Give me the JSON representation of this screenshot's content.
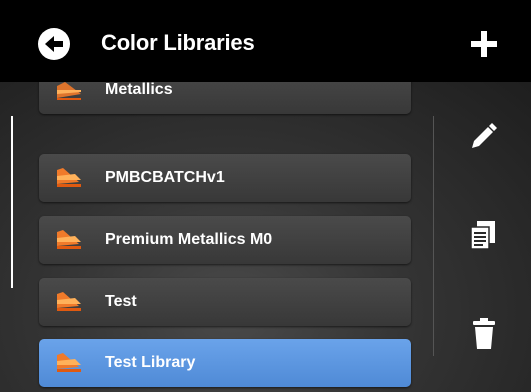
{
  "header": {
    "title": "Color Libraries",
    "back_icon": "back-arrow-icon",
    "add_icon": "plus-icon"
  },
  "libraries": [
    {
      "label": "Metallics",
      "selected": false
    },
    {
      "label": "PMBCBATCHv1",
      "selected": false
    },
    {
      "label": "Premium Metallics M0",
      "selected": false
    },
    {
      "label": "Test",
      "selected": false
    },
    {
      "label": "Test Library",
      "selected": true
    }
  ],
  "actions": {
    "edit_icon": "pencil-icon",
    "copy_icon": "copy-icon",
    "delete_icon": "trash-icon"
  },
  "colors": {
    "accent": "#5b95df",
    "icon_orange": "#f07a2a",
    "header_bg": "#000000"
  }
}
